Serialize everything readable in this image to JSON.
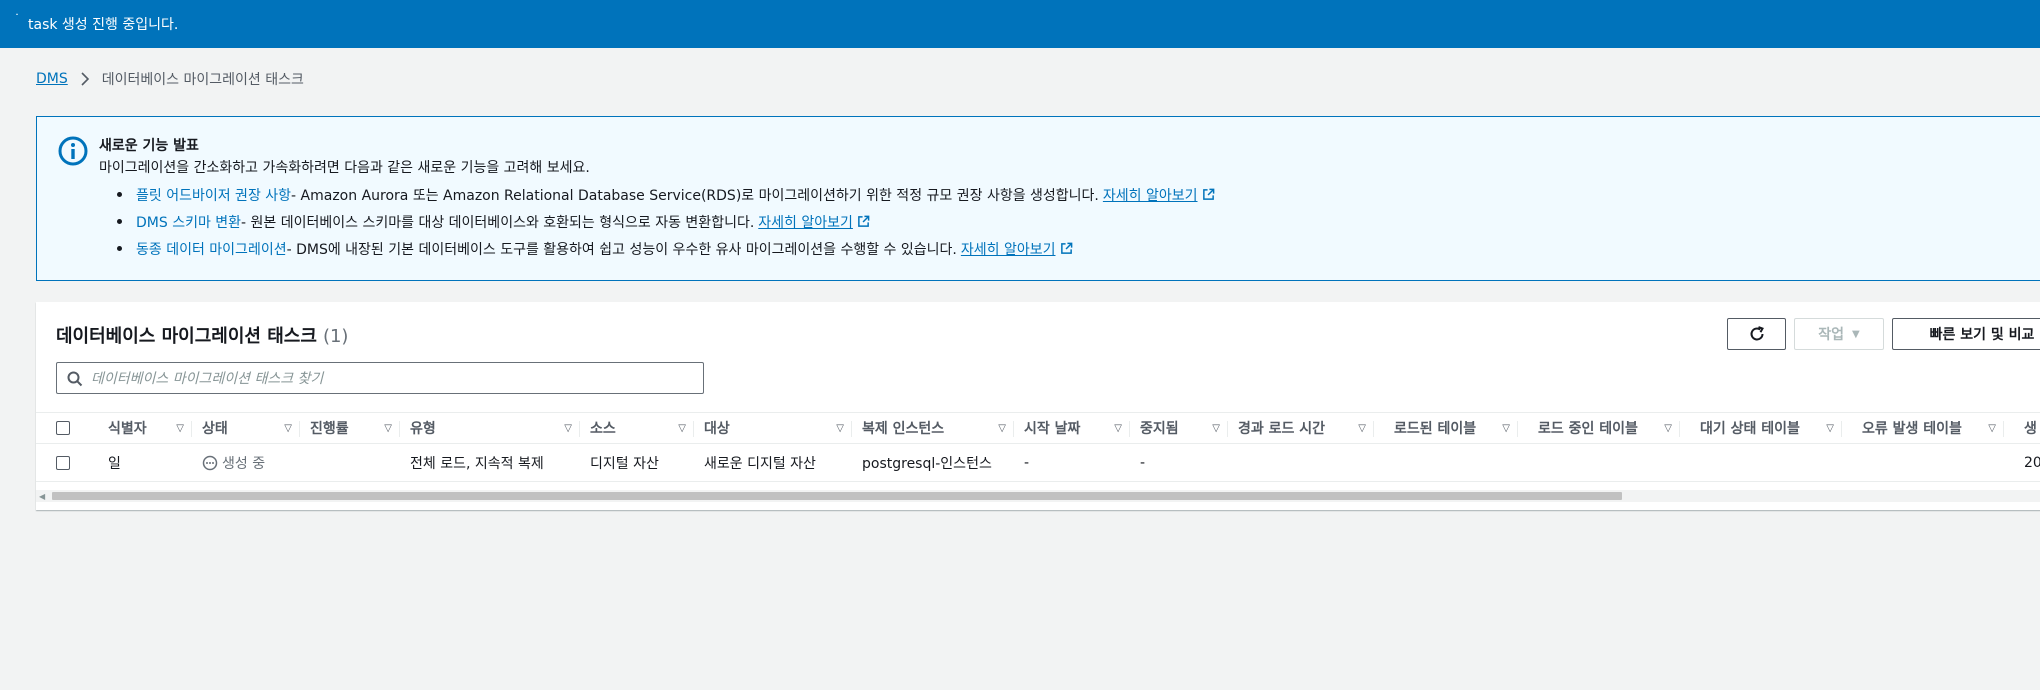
{
  "flash": {
    "message": "task 생성 진행 중입니다."
  },
  "breadcrumb": {
    "root": "DMS",
    "current": "데이터베이스 마이그레이션 태스크"
  },
  "info": {
    "title": "새로운 기능 발표",
    "description": "마이그레이션을 간소화하고 가속화하려면 다음과 같은 새로운 기능을 고려해 보세요.",
    "items": [
      {
        "feature": "플릿 어드바이저 권장 사항",
        "text": " - Amazon Aurora 또는 Amazon Relational Database Service(RDS)로 마이그레이션하기 위한 적정 규모 권장 사항을 생성합니다.",
        "link": "자세히 알아보기"
      },
      {
        "feature": "DMS 스키마 변환",
        "text": " - 원본 데이터베이스 스키마를 대상 데이터베이스와 호환되는 형식으로 자동 변환합니다.",
        "link": "자세히 알아보기"
      },
      {
        "feature": "동종 데이터 마이그레이션",
        "text": " - DMS에 내장된 기본 데이터베이스 도구를 활용하여 쉽고 성능이 우수한 유사 마이그레이션을 수행할 수 있습니다.",
        "link": "자세히 알아보기"
      }
    ]
  },
  "table": {
    "title": "데이터베이스 마이그레이션 태스크",
    "count": "(1)",
    "actions_label": "작업",
    "compare_label": "빠른 보기 및 비교",
    "search_placeholder": "데이터베이스 마이그레이션 태스크 찾기",
    "columns": [
      "식별자",
      "상태",
      "진행률",
      "유형",
      "소스",
      "대상",
      "복제 인스턴스",
      "시작 날짜",
      "중지됨",
      "경과 로드 시간",
      "로드된 테이블",
      "로드 중인 테이블",
      "대기 상태 테이블",
      "오류 발생 테이블",
      "생"
    ],
    "rows": [
      {
        "identifier": "일",
        "status": "생성 중",
        "progress": "",
        "type": "전체 로드, 지속적 복제",
        "source": "디지털 자산",
        "target": "새로운 디지털 자산",
        "instance": "postgresql-인스턴스",
        "start_date": "-",
        "stopped": "-",
        "created": "20"
      }
    ]
  }
}
